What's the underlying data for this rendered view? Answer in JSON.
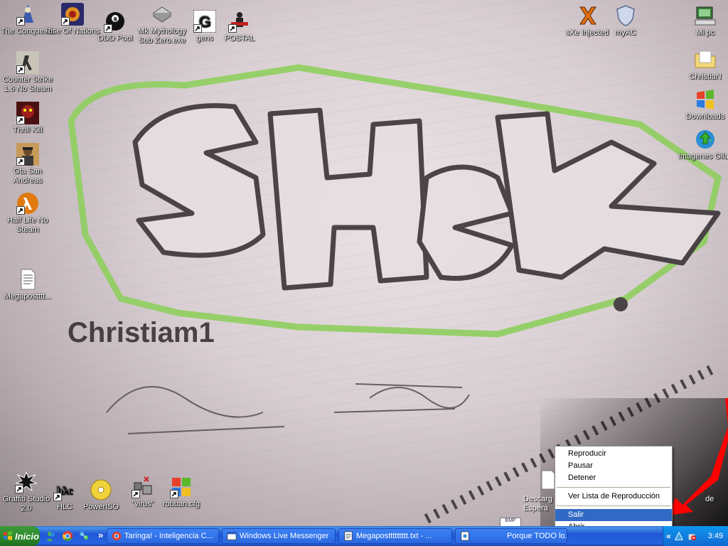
{
  "wallpaper": {
    "graffiti_text": "SHEK",
    "signature_text": "Christiam1"
  },
  "desktop_icons": {
    "the_conqueros": "The Conqueros",
    "rise_of_nations": "Rise Of Nations",
    "ddd_pool": "DDD Pool",
    "mk_mythology": "Mk Mythology Sub Zero.exe",
    "gens": "gens",
    "postal": "POSTAL",
    "counter_strike": "Counter Strike 1.6 No Steam",
    "thrill_kill": "Thrill Kill",
    "gta_san_andreas": "Gta San Andreas",
    "half_life": "Half Life No Steam",
    "megapost": "Megapostttt...",
    "sxe_injected": "sXe Injected",
    "myac": "myAC",
    "mi_pc": "Mi pc",
    "christian": "ChristiaN",
    "downloads": "Downloads",
    "imagenes_gilas": "Imagenes Gilas",
    "graffiti_studio": "Graffiti Studio 2.0",
    "hlc": "HLC",
    "poweriso": "PowerISO",
    "virus": "\"virus\"",
    "robban": "robban.cfg",
    "descargas_partial": "Descarg Espera",
    "de_partial": "de"
  },
  "context_menu": {
    "items": [
      "Reproducir",
      "Pausar",
      "Detener",
      "Ver Lista de Reproducción",
      "Salir",
      "Abrir"
    ],
    "highlighted": "Salir"
  },
  "taskbar": {
    "start_label": "Inicio",
    "overflow": "»",
    "tasks": [
      "Taringa! - Inteligencia C...",
      "Windows Live Messenger",
      "Megaposttttttttt.txt - ...",
      "Porque TODO lo..."
    ],
    "tray_chevron": "«",
    "clock": "3:49"
  },
  "colors": {
    "taskbar_blue": "#245edb",
    "start_green": "#2e8b2e",
    "menu_highlight": "#316ac5",
    "red_arrow": "#ff0000"
  }
}
